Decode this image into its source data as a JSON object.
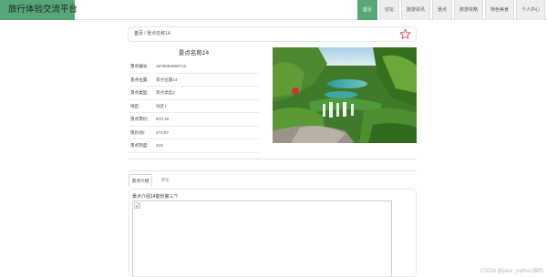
{
  "site": {
    "title": "旅行体验交流平台"
  },
  "nav": {
    "items": [
      {
        "label": "首页",
        "active": true
      },
      {
        "label": "论坛",
        "active": false
      },
      {
        "label": "旅游资讯",
        "active": false
      },
      {
        "label": "景点",
        "active": false
      },
      {
        "label": "旅游攻略",
        "active": false
      },
      {
        "label": "特色美食",
        "active": false
      },
      {
        "label": "个人中心",
        "active": false
      }
    ]
  },
  "breadcrumb": {
    "home": "首页",
    "separator": " / ",
    "current": "景点名称14"
  },
  "favorite": {
    "icon": "star-outline-icon",
    "color": "#d9534f"
  },
  "detail": {
    "title": "景点名称14",
    "rows": [
      {
        "label": "景点编号:",
        "value": "1678084990712"
      },
      {
        "label": "景点位置:",
        "value": "景点位置14"
      },
      {
        "label": "景点类型:",
        "value": "景点类型2"
      },
      {
        "label": "地区:",
        "value": "地区1"
      },
      {
        "label": "景点票价:",
        "value": "670.15"
      },
      {
        "label": "现价/份:",
        "value": "472.67"
      },
      {
        "label": "景点热度:",
        "value": "418"
      }
    ]
  },
  "tabs": [
    {
      "label": "景点介绍",
      "active": true
    },
    {
      "label": "评论",
      "active": false
    }
  ],
  "description": {
    "text": "景点介绍14能份第三个"
  },
  "watermark": "CSDN @java_python源码",
  "colors": {
    "accent": "#57a879",
    "star": "#d9534f"
  }
}
